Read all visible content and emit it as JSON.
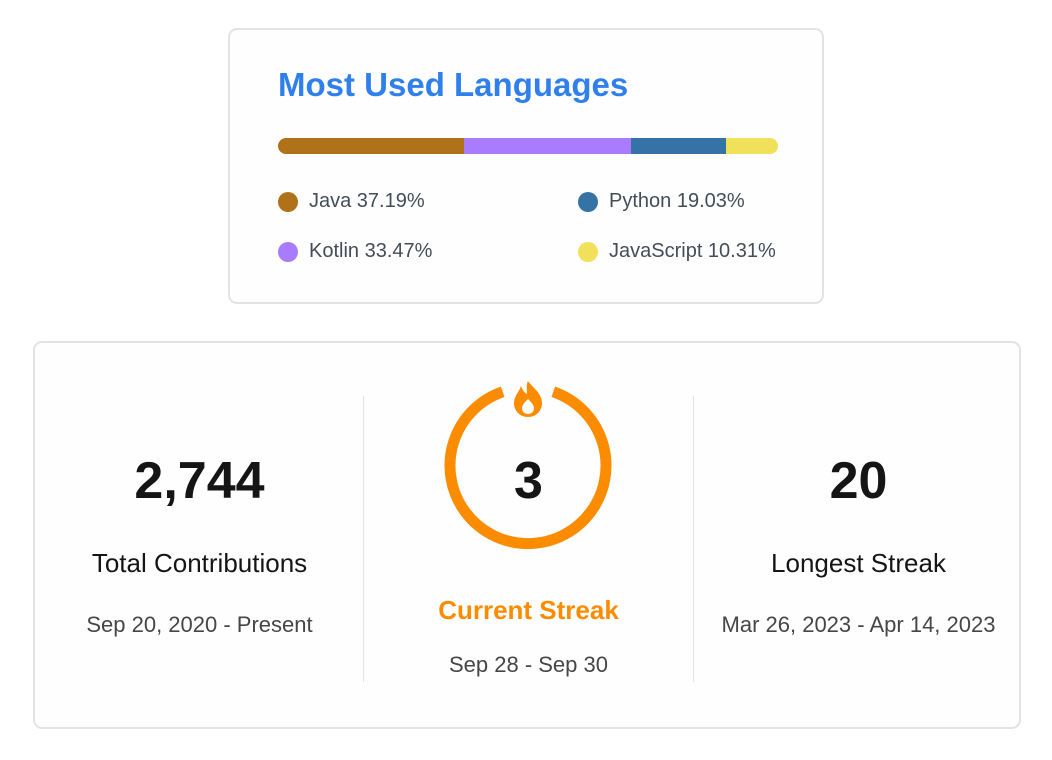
{
  "languages": {
    "title": "Most Used Languages",
    "items": [
      {
        "name": "Java",
        "percent": 37.19,
        "label": "Java 37.19%",
        "color": "#b07219"
      },
      {
        "name": "Kotlin",
        "percent": 33.47,
        "label": "Kotlin 33.47%",
        "color": "#a97bff"
      },
      {
        "name": "Python",
        "percent": 19.03,
        "label": "Python 19.03%",
        "color": "#3572a5"
      },
      {
        "name": "JavaScript",
        "percent": 10.31,
        "label": "JavaScript 10.31%",
        "color": "#f1e05a"
      }
    ]
  },
  "streak": {
    "total": {
      "value": "2,744",
      "label": "Total Contributions",
      "range": "Sep 20, 2020 - Present"
    },
    "current": {
      "value": "3",
      "label": "Current Streak",
      "range": "Sep 28 - Sep 30",
      "icon": "fire-icon",
      "ring_color": "#fb8c00"
    },
    "longest": {
      "value": "20",
      "label": "Longest Streak",
      "range": "Mar 26, 2023 - Apr 14, 2023"
    }
  }
}
